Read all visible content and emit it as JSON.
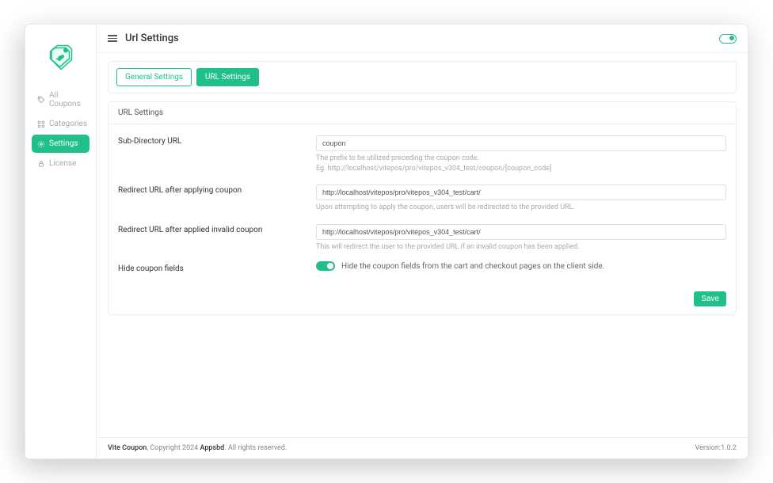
{
  "header": {
    "title": "Url Settings"
  },
  "sidebar": {
    "items": [
      {
        "label": "All Coupons"
      },
      {
        "label": "Categories"
      },
      {
        "label": "Settings"
      },
      {
        "label": "License"
      }
    ]
  },
  "tabs": {
    "general": "General Settings",
    "url": "URL Settings"
  },
  "panel": {
    "title": "URL Settings",
    "sub_dir_label": "Sub-Directory URL",
    "sub_dir_value": "coupon",
    "sub_dir_hint1": "The prefix to be utilized preceding the coupon code.",
    "sub_dir_hint2": "Eg. http://localhost/vitepos/pro/vitepos_v304_test/coupon/[coupon_code]",
    "redirect_ok_label": "Redirect URL after applying coupon",
    "redirect_ok_value": "http://localhost/vitepos/pro/vitepos_v304_test/cart/",
    "redirect_ok_hint": "Upon attempting to apply the coupon, users will be redirected to the provided URL.",
    "redirect_bad_label": "Redirect URL after applied invalid coupon",
    "redirect_bad_value": "http://localhost/vitepos/pro/vitepos_v304_test/cart/",
    "redirect_bad_hint": "This will redirect the user to the provided URL if an invalid coupon has been applied.",
    "hide_label": "Hide coupon fields",
    "hide_desc": "Hide the coupon fields from the cart and checkout pages on the client side.",
    "save": "Save"
  },
  "footer": {
    "brand": "Vite Coupon",
    "copy": ", Copyright 2024 ",
    "link": "Appsbd",
    "rights": ". All rights reserved.",
    "version": "Version:1.0.2"
  }
}
